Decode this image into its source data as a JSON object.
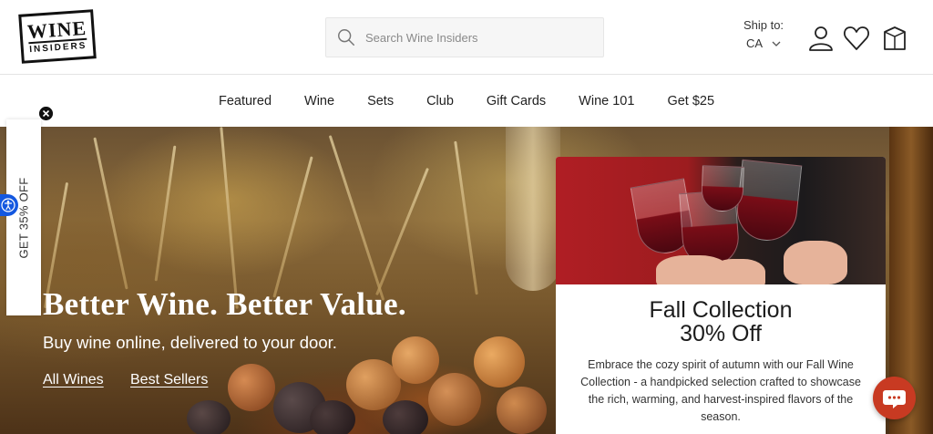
{
  "header": {
    "logo": {
      "line1": "WINE",
      "line2": "INSIDERS"
    },
    "search": {
      "placeholder": "Search Wine Insiders",
      "icon": "search-icon"
    },
    "ship_to": {
      "label": "Ship to:",
      "value": "CA"
    },
    "icons": [
      "account-icon",
      "heart-icon",
      "cart-icon"
    ]
  },
  "nav": {
    "items": [
      "Featured",
      "Wine",
      "Sets",
      "Club",
      "Gift Cards",
      "Wine 101",
      "Get $25"
    ]
  },
  "hero": {
    "title": "Better Wine. Better Value.",
    "subtitle": "Buy wine online, delivered to your door.",
    "links": [
      "All Wines",
      "Best Sellers"
    ]
  },
  "promo": {
    "title_line1": "Fall Collection",
    "title_line2": "30% Off",
    "description": "Embrace the cozy spirit of autumn with our Fall Wine Collection - a handpicked selection crafted to showcase the rich, warming, and harvest-inspired flavors of the season."
  },
  "side_tab": {
    "label": "GET 35% OFF"
  },
  "colors": {
    "chat_button": "#c83a22",
    "accessibility_button": "#1458e0",
    "text_dark": "#222222"
  }
}
